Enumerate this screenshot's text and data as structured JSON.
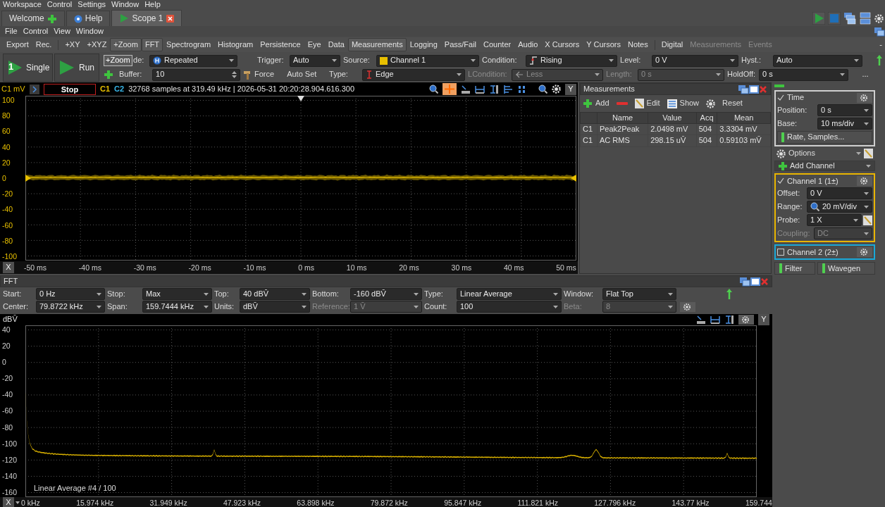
{
  "menu_bar": [
    "Workspace",
    "Control",
    "Settings",
    "Window",
    "Help"
  ],
  "tabs": [
    {
      "label": "Welcome",
      "kind": "add",
      "selected": false
    },
    {
      "label": "Help",
      "kind": "info",
      "selected": false
    },
    {
      "label": "Scope 1",
      "kind": "scope",
      "selected": true
    }
  ],
  "scope_menu": [
    "File",
    "Control",
    "View",
    "Window"
  ],
  "toolbar_groups": [
    [
      {
        "label": "Export",
        "pressed": false,
        "disabled": false
      },
      {
        "label": "Rec.",
        "pressed": false,
        "disabled": false
      }
    ],
    [
      {
        "label": "+XY",
        "pressed": false,
        "disabled": false
      },
      {
        "label": "+XYZ",
        "pressed": false,
        "disabled": false
      },
      {
        "label": "+Zoom",
        "pressed": true,
        "disabled": false
      },
      {
        "label": "FFT",
        "pressed": true,
        "disabled": false
      },
      {
        "label": "Spectrogram",
        "pressed": false,
        "disabled": false
      },
      {
        "label": "Histogram",
        "pressed": false,
        "disabled": false
      },
      {
        "label": "Persistence",
        "pressed": false,
        "disabled": false
      },
      {
        "label": "Eye",
        "pressed": false,
        "disabled": false
      },
      {
        "label": "Data",
        "pressed": false,
        "disabled": false
      },
      {
        "label": "Measurements",
        "pressed": true,
        "disabled": false
      },
      {
        "label": "Logging",
        "pressed": false,
        "disabled": false
      },
      {
        "label": "Pass/Fail",
        "pressed": false,
        "disabled": false
      },
      {
        "label": "Counter",
        "pressed": false,
        "disabled": false
      },
      {
        "label": "Audio",
        "pressed": false,
        "disabled": false
      },
      {
        "label": "X Cursors",
        "pressed": false,
        "disabled": false
      },
      {
        "label": "Y Cursors",
        "pressed": false,
        "disabled": false
      },
      {
        "label": "Notes",
        "pressed": false,
        "disabled": false
      }
    ],
    [
      {
        "label": "Digital",
        "pressed": false,
        "disabled": false
      },
      {
        "label": "Measurements",
        "pressed": false,
        "disabled": true
      },
      {
        "label": "Events",
        "pressed": false,
        "disabled": true
      }
    ]
  ],
  "toolbar_end": "-",
  "run_buttons": [
    {
      "label": "Single",
      "badge": "1"
    },
    {
      "label": "Run"
    }
  ],
  "tooltip": "+Zoom",
  "trigger_rows": [
    [
      {
        "label": "de:",
        "value": "Repeated",
        "kind": "select",
        "disabled": false
      },
      {
        "label": "Trigger:",
        "value": "Auto",
        "kind": "select",
        "disabled": false
      },
      {
        "label": "Source:",
        "value": "Channel 1",
        "kind": "select",
        "disabled": false
      },
      {
        "label": "Condition:",
        "value": "Rising",
        "kind": "select",
        "disabled": false
      },
      {
        "label": "Level:",
        "value": "0 V",
        "kind": "combo",
        "disabled": false
      },
      {
        "label": "Hyst.:",
        "value": "Auto",
        "kind": "combo",
        "disabled": false
      }
    ],
    [
      {
        "label": "Buffer:",
        "value": "10",
        "kind": "spin",
        "disabled": false
      },
      {
        "kind": "buttons",
        "buttons": [
          "Force",
          "Auto Set"
        ]
      },
      {
        "label": "Type:",
        "value": "Edge",
        "kind": "select",
        "disabled": false
      },
      {
        "label": "LCondition:",
        "value": "Less",
        "kind": "select",
        "disabled": true
      },
      {
        "label": "Length:",
        "value": "0 s",
        "kind": "combo",
        "disabled": true
      },
      {
        "label": "HoldOff:",
        "value": "0 s",
        "kind": "combo",
        "disabled": false
      }
    ]
  ],
  "trigger_more": "...",
  "scope": {
    "unit_label": "C1 mV",
    "status": "Stop",
    "channels": [
      {
        "label": "C1",
        "color": "#e8c000"
      },
      {
        "label": "C2",
        "color": "#38b6e8"
      }
    ],
    "info": "32768 samples at 319.49 kHz | 2026-05-31 20:20:28.904.616.300",
    "y_button": "Y",
    "x_button": "X",
    "yticks": [
      "100",
      "80",
      "60",
      "40",
      "20",
      "0",
      "-20",
      "-40",
      "-60",
      "-80",
      "-100"
    ],
    "xticks": [
      "-50 ms",
      "-40 ms",
      "-30 ms",
      "-20 ms",
      "-10 ms",
      "0 ms",
      "10 ms",
      "20 ms",
      "30 ms",
      "40 ms",
      "50 ms"
    ]
  },
  "measurements": {
    "title": "Measurements",
    "toolbar": [
      {
        "label": "Add",
        "kind": "add"
      },
      {
        "kind": "remove"
      },
      {
        "label": "Edit",
        "kind": "edit"
      },
      {
        "label": "Show",
        "kind": "show"
      },
      {
        "kind": "settings"
      },
      {
        "label": "Reset",
        "kind": "plain"
      }
    ],
    "columns": [
      "",
      "Name",
      "Value",
      "Acq",
      "Mean"
    ],
    "rows": [
      [
        "C1",
        "Peak2Peak",
        "2.0498 mV",
        "504",
        "3.3304 mV"
      ],
      [
        "C1",
        "AC RMS",
        "298.15 uV̄",
        "504",
        "0.59103 mV̄"
      ]
    ]
  },
  "side_panel": {
    "time": {
      "title": "Time",
      "checked": true,
      "fields": [
        {
          "label": "Position:",
          "value": "0 s"
        },
        {
          "label": "Base:",
          "value": "10 ms/div"
        }
      ],
      "button": "Rate, Samples..."
    },
    "options": "Options",
    "add_channel": "Add Channel",
    "channels": [
      {
        "title": "Channel 1 (1±)",
        "checked": true,
        "color": "#e8b400",
        "fields": [
          {
            "label": "Offset:",
            "value": "0 V",
            "kind": "combo",
            "disabled": false
          },
          {
            "label": "Range:",
            "value": "20 mV/div",
            "kind": "zoom",
            "disabled": false
          },
          {
            "label": "Probe:",
            "value": "1 X",
            "kind": "probe",
            "disabled": false
          },
          {
            "label": "Coupling:",
            "value": "DC",
            "kind": "combo",
            "disabled": true
          }
        ]
      },
      {
        "title": "Channel 2 (2±)",
        "checked": false,
        "color": "#19a8d8"
      }
    ],
    "buttons": [
      "Filter",
      "Wavegen"
    ]
  },
  "fft": {
    "title": "FFT",
    "rows": [
      [
        {
          "label": "Start:",
          "value": "0 Hz",
          "disabled": false
        },
        {
          "label": "Stop:",
          "value": "Max",
          "disabled": false
        },
        {
          "label": "Top:",
          "value": "40 dBV̄",
          "disabled": false
        },
        {
          "label": "Bottom:",
          "value": "-160 dBV̄",
          "disabled": false
        },
        {
          "label": "Type:",
          "value": "Linear Average",
          "disabled": false
        },
        {
          "label": "Window:",
          "value": "Flat Top",
          "disabled": false
        }
      ],
      [
        {
          "label": "Center:",
          "value": "79.8722 kHz",
          "disabled": false
        },
        {
          "label": "Span:",
          "value": "159.7444 kHz",
          "disabled": false
        },
        {
          "label": "Units:",
          "value": "dBV̄",
          "disabled": false
        },
        {
          "label": "Reference:",
          "value": "1 V̄",
          "disabled": true
        },
        {
          "label": "Count:",
          "value": "100",
          "disabled": false
        },
        {
          "label": "Beta:",
          "value": "8",
          "disabled": true
        }
      ]
    ],
    "unit_label": "dBV̄",
    "y_button": "Y",
    "x_button": "X",
    "annotation": "Linear Average #4 / 100",
    "yticks": [
      "40",
      "20",
      "0",
      "-20",
      "-40",
      "-60",
      "-80",
      "-100",
      "-120",
      "-140",
      "-160"
    ],
    "xticks": [
      "0 kHz",
      "15.974 kHz",
      "31.949 kHz",
      "47.923 kHz",
      "63.898 kHz",
      "79.872 kHz",
      "95.847 kHz",
      "111.821 kHz",
      "127.796 kHz",
      "143.77 kHz",
      "159.744"
    ]
  }
}
